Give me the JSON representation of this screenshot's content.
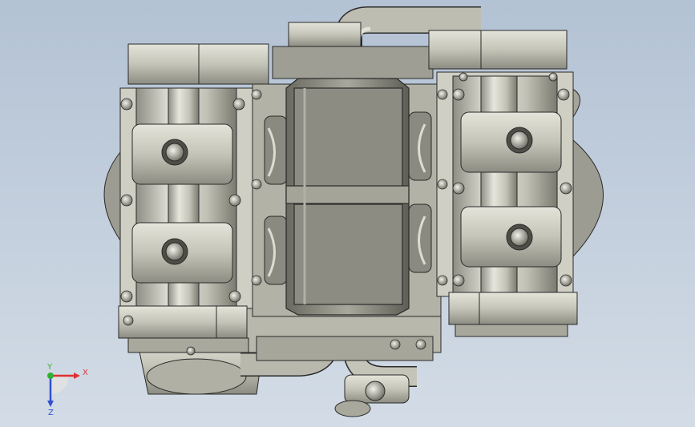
{
  "viewport": {
    "background_top": "#b3c2d4",
    "background_bottom": "#d3dce6"
  },
  "model": {
    "name": "engine-assembly",
    "metal_color": "#c9c9bd",
    "edge_color": "#2a2a2a"
  },
  "triad": {
    "x_label": "X",
    "y_label": "Y",
    "z_label": "Z",
    "x_color": "#e03030",
    "y_color": "#30b030",
    "z_color": "#3050d0"
  }
}
